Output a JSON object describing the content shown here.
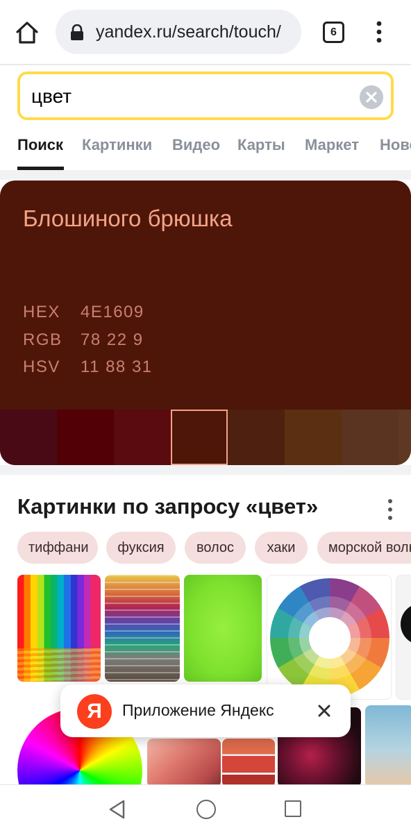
{
  "browser": {
    "url": "yandex.ru/search/touch/",
    "tab_count": "6"
  },
  "search": {
    "query": "цвет"
  },
  "service_tabs": [
    {
      "label": "Поиск",
      "active": true
    },
    {
      "label": "Картинки",
      "active": false
    },
    {
      "label": "Видео",
      "active": false
    },
    {
      "label": "Карты",
      "active": false
    },
    {
      "label": "Маркет",
      "active": false
    },
    {
      "label": "Новости",
      "active": false
    }
  ],
  "color_card": {
    "name": "Блошиного брюшка",
    "background": "#4e1609",
    "codes": [
      {
        "label": "HEX",
        "value": "4E1609"
      },
      {
        "label": "RGB",
        "value": "78 22 9"
      },
      {
        "label": "HSV",
        "value": "11 88 31"
      }
    ],
    "swatches": [
      "#4a0a15",
      "#520005",
      "#5a0b10",
      "#4e1609",
      "#4e200f",
      "#5b3012",
      "#5a3420",
      "#5e3823"
    ],
    "selected_swatch_index": 3
  },
  "images": {
    "title": "Картинки по запросу «цвет»",
    "chips": [
      "тиффани",
      "фуксия",
      "волос",
      "хаки",
      "морской волны"
    ]
  },
  "app_promo": {
    "logo_letter": "Я",
    "text": "Приложение Яндекс"
  }
}
